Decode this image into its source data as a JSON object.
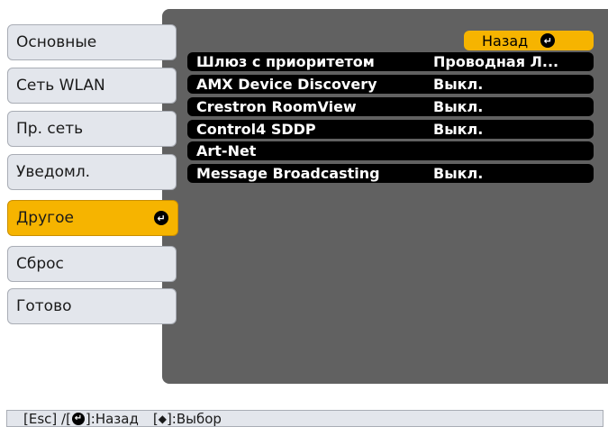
{
  "sidebar": {
    "items": [
      {
        "label": "Основные"
      },
      {
        "label": "Сеть WLAN"
      },
      {
        "label": "Пр. сеть"
      },
      {
        "label": "Уведомл."
      },
      {
        "label": "Другое"
      },
      {
        "label": "Сброс"
      },
      {
        "label": "Готово"
      }
    ],
    "active_index": 4
  },
  "main": {
    "back_label": "Назад",
    "rows": [
      {
        "label": "Шлюз с приоритетом",
        "value": "Проводная Л..."
      },
      {
        "label": "AMX Device Discovery",
        "value": "Выкл."
      },
      {
        "label": "Crestron RoomView",
        "value": "Выкл."
      },
      {
        "label": "Control4 SDDP",
        "value": "Выкл."
      },
      {
        "label": "Art-Net",
        "value": ""
      },
      {
        "label": "Message Broadcasting",
        "value": "Выкл."
      }
    ]
  },
  "footer": {
    "esc": "[Esc] /[",
    "back": "]:Назад",
    "select_open": "[",
    "select_icon": "◆",
    "select": "]:Выбор"
  },
  "colors": {
    "accent": "#f6b400",
    "panel": "#616161",
    "tab": "#e3e6ec",
    "row": "#000000"
  }
}
